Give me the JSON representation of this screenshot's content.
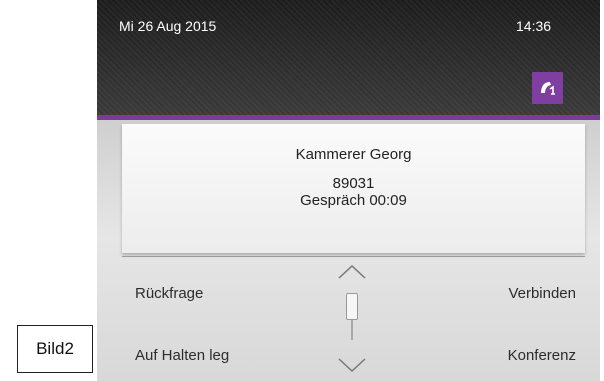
{
  "caption": "Bild2",
  "statusbar": {
    "date": "Mi 26 Aug 2015",
    "time": "14:36"
  },
  "call_button": {
    "icon": "handset-icon",
    "color": "#7f3fa0"
  },
  "accent_color": "#7c3a99",
  "call": {
    "name": "Kammerer Georg",
    "number": "89031",
    "duration": "Gespräch 00:09"
  },
  "softkeys": {
    "left": [
      "Rückfrage",
      "Auf Halten leg"
    ],
    "right": [
      "Verbinden",
      "Konferenz"
    ]
  },
  "scroller": {
    "up_icon": "chevron-up-icon",
    "down_icon": "chevron-down-icon"
  }
}
